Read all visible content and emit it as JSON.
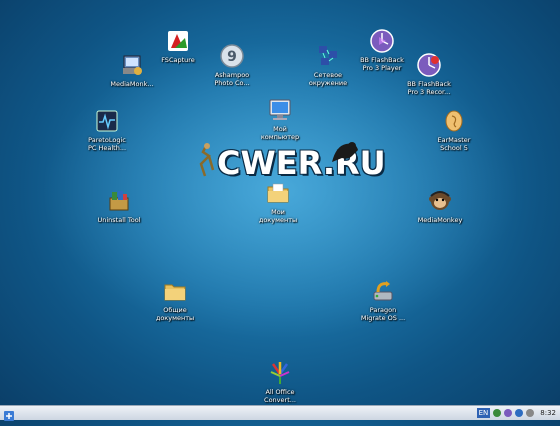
{
  "desktop": {
    "icons": [
      {
        "label": "FSCapture"
      },
      {
        "label": "MediaMonk..."
      },
      {
        "label": "Ashampoo\nPhoto Co..."
      },
      {
        "label": "Сетевое\nокружение"
      },
      {
        "label": "BB FlashBack\nPro 3 Player"
      },
      {
        "label": "BB FlashBack\nPro 3 Recor..."
      },
      {
        "label": "Мой\nкомпьютер"
      },
      {
        "label": "ParetoLogic\nPC Health..."
      },
      {
        "label": "EarMaster\nSchool 5"
      },
      {
        "label": "Uninstall Tool"
      },
      {
        "label": "Мои\nдокументы"
      },
      {
        "label": "MediaMonkey"
      },
      {
        "label": "Общие\nдокументы"
      },
      {
        "label": "Paragon\nMigrate OS ..."
      },
      {
        "label": "All Office\nConvert..."
      }
    ],
    "watermark": "CWER.RU"
  },
  "taskbar": {
    "language": "EN",
    "clock": "8:32"
  }
}
